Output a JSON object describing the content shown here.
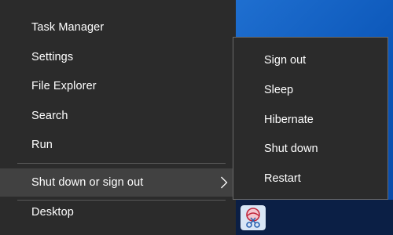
{
  "main_menu": {
    "items": [
      {
        "label": "Task Manager"
      },
      {
        "label": "Settings"
      },
      {
        "label": "File Explorer"
      },
      {
        "label": "Search"
      },
      {
        "label": "Run"
      }
    ],
    "shutdown_item": {
      "label": "Shut down or sign out",
      "highlighted": true
    },
    "desktop_item": {
      "label": "Desktop"
    }
  },
  "submenu": {
    "items": [
      {
        "label": "Sign out"
      },
      {
        "label": "Sleep"
      },
      {
        "label": "Hibernate"
      },
      {
        "label": "Shut down"
      },
      {
        "label": "Restart"
      }
    ]
  },
  "icons": {
    "chevron": "chevron-right-icon",
    "tray": "snipping-tool-icon"
  },
  "colors": {
    "menu_bg": "#2b2b2b",
    "highlight_bg": "#414141",
    "text": "#ffffff",
    "desktop_blue": "#0b56b8"
  }
}
